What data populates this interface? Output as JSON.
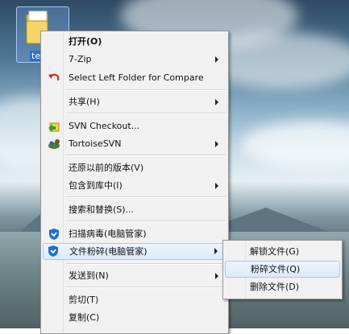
{
  "desktop_icon": {
    "label": "tes"
  },
  "context_menu": {
    "open": "打开(O)",
    "sevenzip": "7-Zip",
    "compare": "Select Left Folder for Compare",
    "share": "共享(H)",
    "svn_checkout": "SVN Checkout...",
    "tortoise": "TortoiseSVN",
    "restore": "还原以前的版本(V)",
    "include_library": "包含到库中(I)",
    "search_replace": "搜索和替换(S)...",
    "scan_virus": "扫描病毒(电脑管家)",
    "shred": "文件粉碎(电脑管家)",
    "send_to": "发送到(N)",
    "cut": "剪切(T)",
    "copy": "复制(C)"
  },
  "shred_submenu": {
    "unlock": "解锁文件(G)",
    "shred_file": "粉碎文件(Q)",
    "delete_file": "删除文件(D)"
  },
  "colors": {
    "highlight_border": "#a8c8ec",
    "menu_bg": "#f1f1f1"
  }
}
